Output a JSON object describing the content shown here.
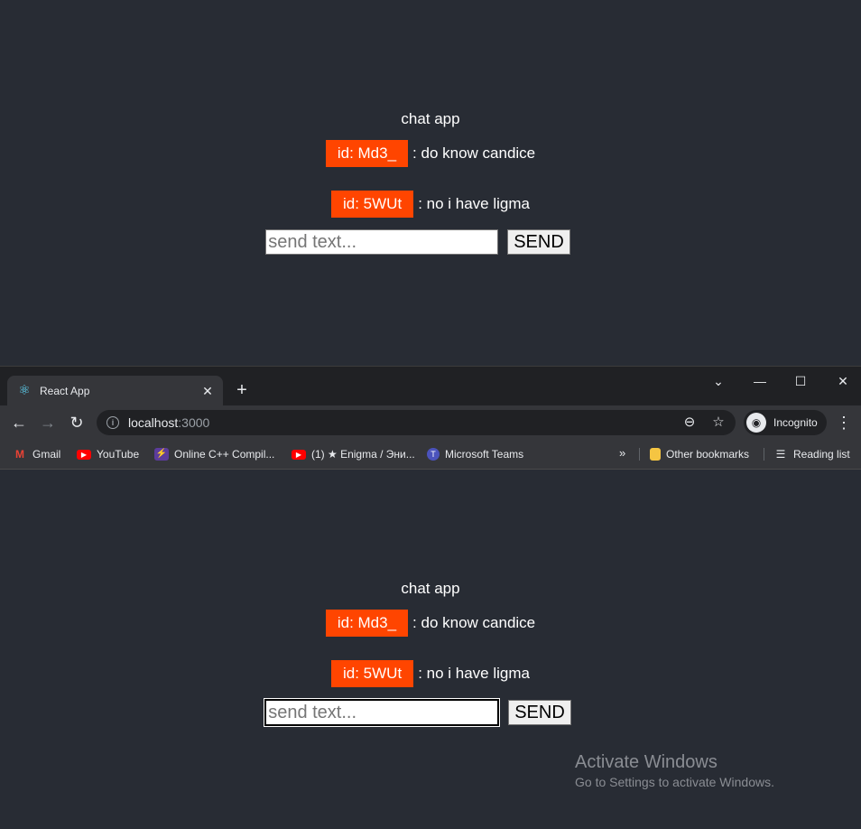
{
  "app": {
    "title": "chat app",
    "messages": [
      {
        "id_label": "id: Md3_",
        "text": ": do know candice"
      },
      {
        "id_label": "id: 5WUt",
        "text": ": no i have ligma"
      }
    ],
    "input_placeholder": "send text...",
    "send_label": "SEND"
  },
  "browser": {
    "tab_title": "React App",
    "url_host": "localhost",
    "url_port": ":3000",
    "incognito_label": "Incognito",
    "bookmarks": [
      {
        "label": "Gmail",
        "icon": "gmail-icon"
      },
      {
        "label": "YouTube",
        "icon": "youtube-icon"
      },
      {
        "label": "Online C++ Compil...",
        "icon": "compiler-icon"
      },
      {
        "label": "(1) ★ Enigma / Эни...",
        "icon": "youtube-icon"
      },
      {
        "label": "Microsoft Teams",
        "icon": "teams-icon"
      }
    ],
    "other_bookmarks": "Other bookmarks",
    "reading_list": "Reading list"
  },
  "watermark": {
    "title": "Activate Windows",
    "subtitle": "Go to Settings to activate Windows."
  },
  "colors": {
    "app_bg": "#282c34",
    "id_badge": "#ff4500"
  }
}
